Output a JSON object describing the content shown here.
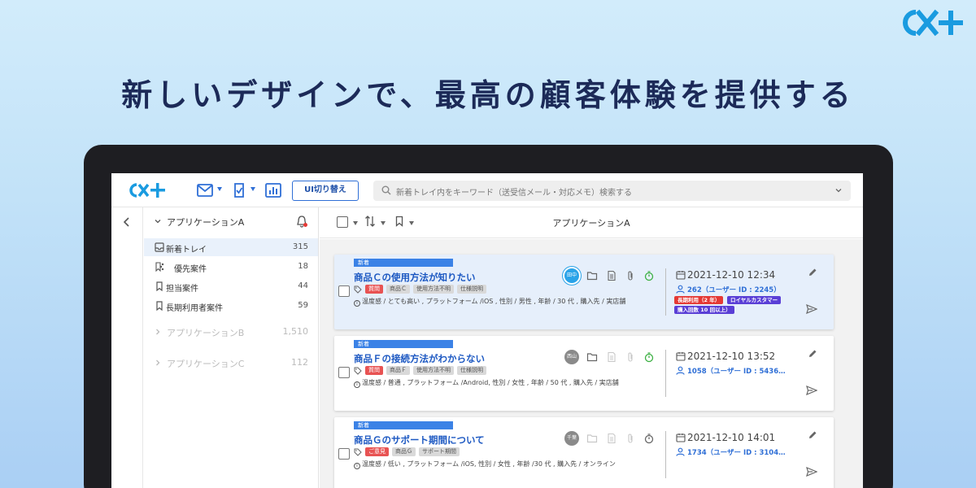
{
  "brand": {
    "logo_text": "CX+"
  },
  "headline": "新しいデザインで、最高の顧客体験を提供する",
  "app": {
    "logo_text": "CX+",
    "toolbar": {
      "mail_icon": "mail-icon",
      "task_icon": "check-doc-icon",
      "report_icon": "chart-icon",
      "ui_switch_label": "UI切り替え"
    },
    "search": {
      "placeholder": "新着トレイ内をキーワード（送受信メール・対応メモ）検索する"
    },
    "sidebar": {
      "group": {
        "label": "アプリケーションA"
      },
      "items": [
        {
          "label": "新着トレイ",
          "count": "315",
          "icon": "inbox-icon"
        },
        {
          "label": "優先案件",
          "count": "18",
          "icon": "bookmark-share-icon"
        },
        {
          "label": "担当案件",
          "count": "44",
          "icon": "bookmark-icon"
        },
        {
          "label": "長期利用者案件",
          "count": "59",
          "icon": "bookmark-icon"
        }
      ],
      "other_groups": [
        {
          "label": "アプリケーションB",
          "count": "1,510"
        },
        {
          "label": "アプリケーションC",
          "count": "112"
        }
      ]
    },
    "main": {
      "title": "アプリケーションA",
      "cards": [
        {
          "new_label": "新着",
          "title": "商品Ｃの使用方法が知りたい",
          "chips": [
            {
              "text": "質問",
              "style": "red"
            },
            {
              "text": "商品Ｃ",
              "style": "gray"
            },
            {
              "text": "使用方法不明",
              "style": "gray"
            },
            {
              "text": "仕様説明",
              "style": "gray"
            }
          ],
          "attributes": "温度感 / とても高い , プラットフォーム /iOS , 性別 / 男性 , 年齢 / 30 代 , 購入先 / 実店舗",
          "avatar_text": "田中",
          "avatar_color": "#2aa3e8",
          "date": "2021-12-10 12:34",
          "user": "262（ユーザー ID : 2245）",
          "badges": [
            {
              "text": "長期利用（2 年）",
              "style": "red"
            },
            {
              "text": "ロイヤルカスタマー",
              "style": "purple"
            },
            {
              "text": "購入回数 10 回以上）",
              "style": "purple"
            }
          ],
          "selected": true
        },
        {
          "new_label": "新着",
          "title": "商品Ｆの接続方法がわからない",
          "chips": [
            {
              "text": "質問",
              "style": "red"
            },
            {
              "text": "商品Ｆ",
              "style": "gray"
            },
            {
              "text": "使用方法不明",
              "style": "gray"
            },
            {
              "text": "仕様説明",
              "style": "gray"
            }
          ],
          "attributes": "温度感 / 普通 , プラットフォーム /Android, 性別 / 女性 , 年齢 / 50 代 , 購入先 / 実店舗",
          "avatar_text": "西山",
          "avatar_color": "#8a8a8a",
          "date": "2021-12-10 13:52",
          "user": "1058（ユーザー ID : 5436…",
          "badges": [],
          "selected": false
        },
        {
          "new_label": "新着",
          "title": "商品Ｇのサポート期間について",
          "chips": [
            {
              "text": "ご意見",
              "style": "red"
            },
            {
              "text": "商品Ｇ",
              "style": "gray"
            },
            {
              "text": "サポート期間",
              "style": "gray"
            }
          ],
          "attributes": "温度感 / 低い , プラットフォーム /iOS, 性別 / 女性 , 年齢 /30 代 , 購入先 / オンライン",
          "avatar_text": "千葉",
          "avatar_color": "#8a8a8a",
          "date": "2021-12-10 14:01",
          "user": "1734（ユーザー ID : 3104…",
          "badges": [],
          "selected": false
        }
      ]
    }
  },
  "colors": {
    "accent": "#2f6fd6",
    "brand": "#1a9be0",
    "headline": "#1c2a58"
  }
}
